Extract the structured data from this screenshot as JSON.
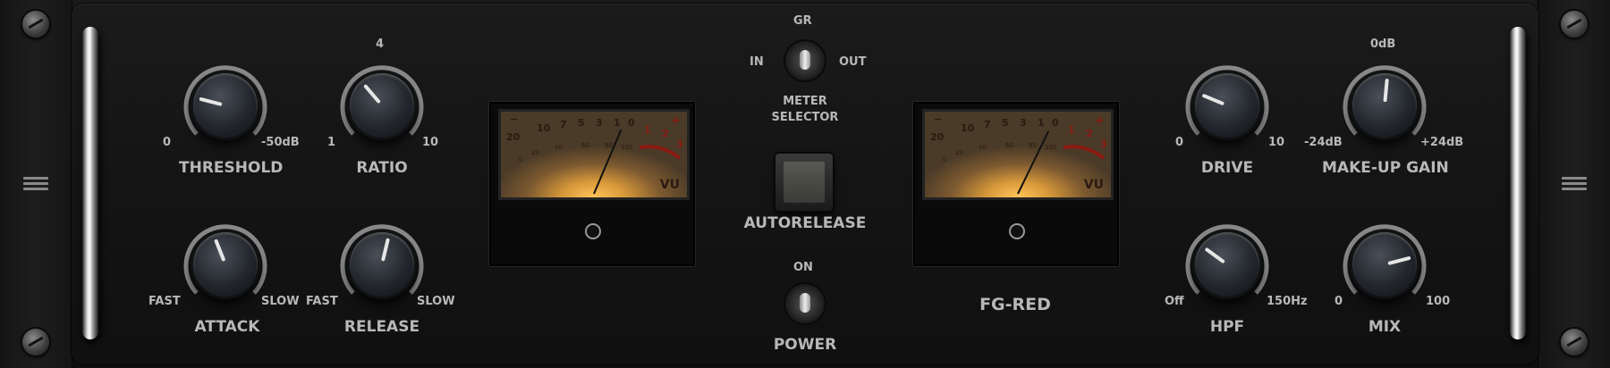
{
  "left_section": {
    "threshold": {
      "label": "THRESHOLD",
      "min": "0",
      "max": "-50dB",
      "value_fraction": 0.22
    },
    "ratio": {
      "label": "RATIO",
      "min": "1",
      "max": "10",
      "top": "4",
      "value_fraction": 0.35
    },
    "attack": {
      "label": "ATTACK",
      "min": "FAST",
      "max": "SLOW",
      "value_fraction": 0.42
    },
    "release": {
      "label": "RELEASE",
      "min": "FAST",
      "max": "SLOW",
      "value_fraction": 0.55
    }
  },
  "meter_selector": {
    "top": "GR",
    "left": "IN",
    "right": "OUT",
    "label_line1": "METER",
    "label_line2": "SELECTOR"
  },
  "autorelease": {
    "label": "AUTORELEASE"
  },
  "power": {
    "top": "ON",
    "label": "POWER"
  },
  "brand": {
    "name": "FG-RED"
  },
  "vu_meter": {
    "scale_top": [
      "20",
      "10",
      "7",
      "5",
      "3",
      "1",
      "0",
      "1",
      "2",
      "3"
    ],
    "scale_bottom": [
      "0",
      "20",
      "40",
      "60",
      "80",
      "100"
    ],
    "minus": "−",
    "plus": "+",
    "unit": "VU",
    "left_needle_fraction": 0.73,
    "right_needle_fraction": 0.76
  },
  "right_section": {
    "drive": {
      "label": "DRIVE",
      "min": "0",
      "max": "10",
      "value_fraction": 0.25
    },
    "makeup": {
      "label": "MAKE-UP GAIN",
      "min": "-24dB",
      "max": "+24dB",
      "top": "0dB",
      "value_fraction": 0.52
    },
    "hpf": {
      "label": "HPF",
      "min": "Off",
      "max": "150Hz",
      "value_fraction": 0.3
    },
    "mix": {
      "label": "MIX",
      "min": "0",
      "max": "100",
      "value_fraction": 0.78
    }
  }
}
